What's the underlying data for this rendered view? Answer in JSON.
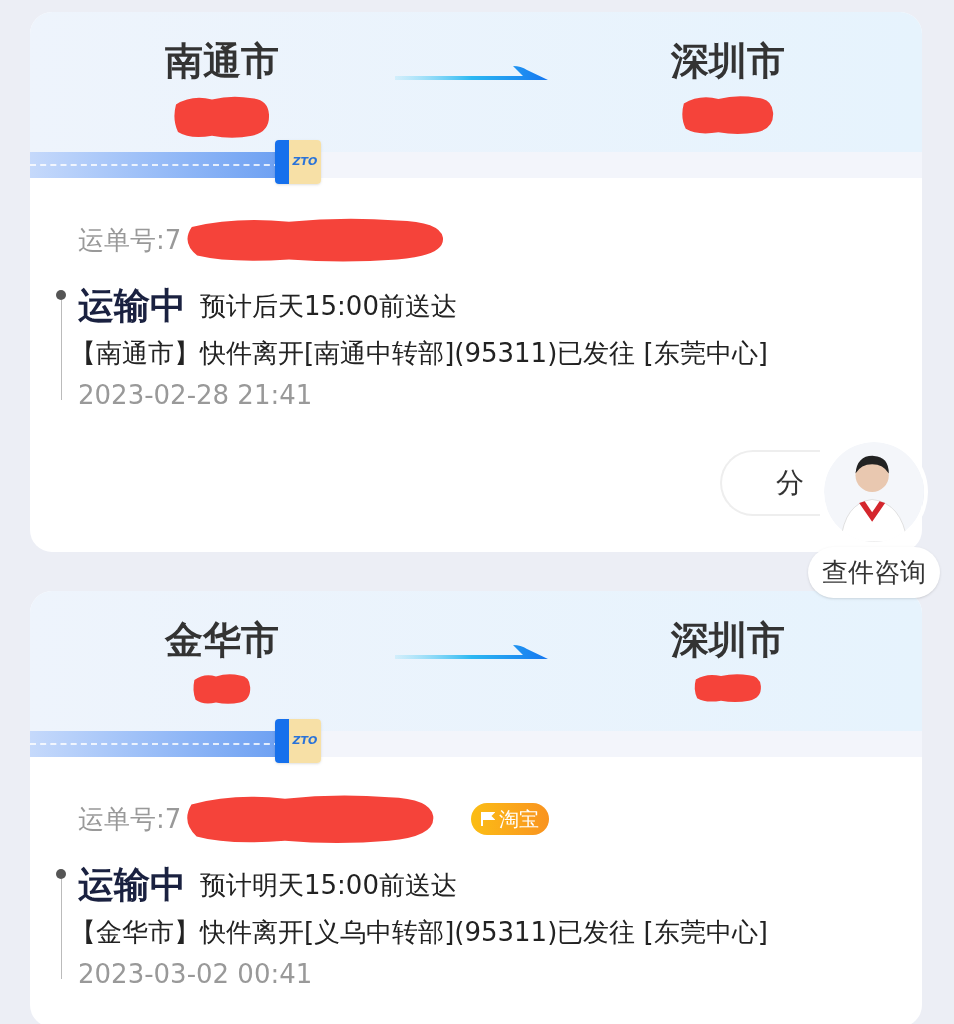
{
  "shipments": [
    {
      "origin": "南通市",
      "destination": "深圳市",
      "carrier_logo": "ZTO",
      "waybill_label": "运单号:7",
      "status": "运输中",
      "eta": "预计后天15:00前送达",
      "event": "【南通市】快件离开[南通中转部](95311)已发往 [东莞中心]",
      "time": "2023-02-28 21:41",
      "share_button": "分"
    },
    {
      "origin": "金华市",
      "destination": "深圳市",
      "carrier_logo": "ZTO",
      "waybill_label": "运单号:7",
      "tag": "淘宝",
      "status": "运输中",
      "eta": "预计明天15:00前送达",
      "event": "【金华市】快件离开[义乌中转部](95311)已发往 [东莞中心]",
      "time": "2023-03-02 00:41"
    }
  ],
  "support_widget": {
    "label": "查件咨询"
  }
}
